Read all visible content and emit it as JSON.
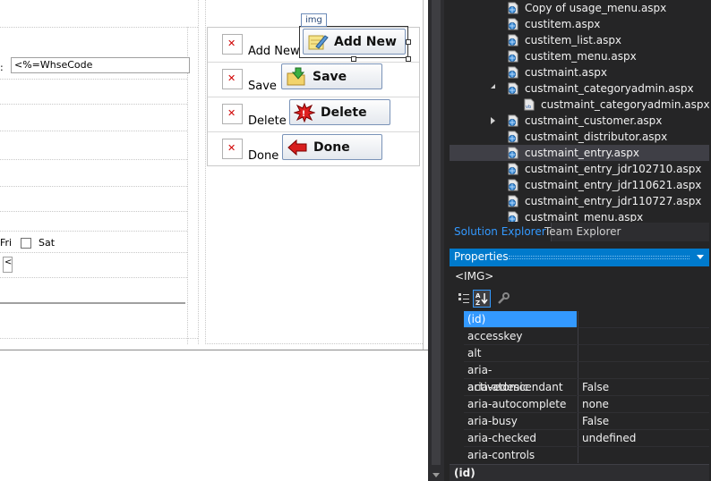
{
  "designer": {
    "whse_prefix": ":",
    "whse_value": "<%=WhseCode",
    "days": [
      {
        "label": "Fri"
      },
      {
        "label": "Sat"
      }
    ],
    "small_input_value": "<",
    "selection_tag": "img",
    "rows": [
      {
        "label": "Add New",
        "button": "Add New",
        "icon": "notepad-pencil-icon"
      },
      {
        "label": "Save",
        "button": "Save",
        "icon": "folder-arrow-icon"
      },
      {
        "label": "Delete",
        "button": "Delete",
        "icon": "delete-burst-icon"
      },
      {
        "label": "Done",
        "button": "Done",
        "icon": "red-left-arrow-icon"
      }
    ]
  },
  "solution_explorer": {
    "items": [
      {
        "label": "Copy of usage_menu.aspx",
        "level": 0,
        "icon": "web-file-icon"
      },
      {
        "label": "custitem.aspx",
        "level": 0,
        "icon": "web-file-icon"
      },
      {
        "label": "custitem_list.aspx",
        "level": 0,
        "icon": "web-file-icon"
      },
      {
        "label": "custitem_menu.aspx",
        "level": 0,
        "icon": "web-file-icon"
      },
      {
        "label": "custmaint.aspx",
        "level": 0,
        "icon": "web-file-icon"
      },
      {
        "label": "custmaint_categoryadmin.aspx",
        "level": 0,
        "icon": "web-file-icon",
        "expander": "open"
      },
      {
        "label": "custmaint_categoryadmin.aspx.vb",
        "level": 1,
        "icon": "vb-file-icon"
      },
      {
        "label": "custmaint_customer.aspx",
        "level": 0,
        "icon": "web-file-icon",
        "expander": "closed"
      },
      {
        "label": "custmaint_distributor.aspx",
        "level": 0,
        "icon": "web-file-icon"
      },
      {
        "label": "custmaint_entry.aspx",
        "level": 0,
        "icon": "web-file-icon",
        "selected": true
      },
      {
        "label": "custmaint_entry_jdr102710.aspx",
        "level": 0,
        "icon": "web-file-icon"
      },
      {
        "label": "custmaint_entry_jdr110621.aspx",
        "level": 0,
        "icon": "web-file-icon"
      },
      {
        "label": "custmaint_entry_jdr110727.aspx",
        "level": 0,
        "icon": "web-file-icon"
      },
      {
        "label": "custmaint_menu.aspx",
        "level": 0,
        "icon": "web-file-icon"
      }
    ]
  },
  "tabs": [
    {
      "label": "Solution Explorer",
      "active": true
    },
    {
      "label": "Team Explorer",
      "active": false
    }
  ],
  "properties": {
    "title": "Properties",
    "object": "<IMG>",
    "toolbar": [
      {
        "icon": "categorized-icon",
        "active": false
      },
      {
        "icon": "alphabetical-icon",
        "active": true
      },
      {
        "icon": "wrench-icon",
        "active": false
      }
    ],
    "rows": [
      {
        "name": "(id)",
        "value": "",
        "selected": true
      },
      {
        "name": "accesskey",
        "value": ""
      },
      {
        "name": "alt",
        "value": ""
      },
      {
        "name": "aria-activedescendant",
        "value": ""
      },
      {
        "name": "aria-atomic",
        "value": "False"
      },
      {
        "name": "aria-autocomplete",
        "value": "none"
      },
      {
        "name": "aria-busy",
        "value": "False"
      },
      {
        "name": "aria-checked",
        "value": "undefined"
      },
      {
        "name": "aria-controls",
        "value": ""
      }
    ],
    "description": "(id)"
  },
  "colors": {
    "accent": "#007acc",
    "selection": "#3399ff",
    "panel_bg": "#252526"
  }
}
